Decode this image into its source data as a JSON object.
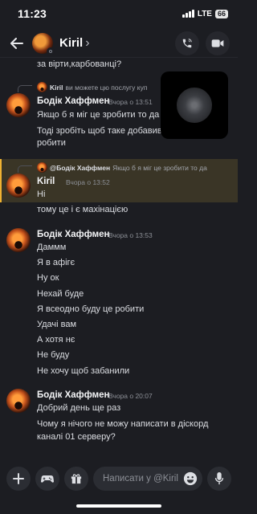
{
  "status": {
    "time": "11:23",
    "network": "LTE",
    "battery": "66"
  },
  "header": {
    "name": "Kiril",
    "chevron": "›"
  },
  "messages": {
    "prev_tail": "за вірти,карбованці?",
    "m1": {
      "reply_name": "Kiril",
      "reply_text": "ви можете цю послугу куп",
      "user": "Бодік Хаффмен",
      "time": "Вчора о 13:51",
      "lines": [
        "Якщо б я міг це зробити то да",
        "Тоді зробіть щоб таке добавив",
        "робити"
      ]
    },
    "m2": {
      "reply_name": "@Бодік Хаффмен",
      "reply_text": "Якщо б я міг це зробити то да",
      "user": "Kiril",
      "time": "Вчора о 13:52",
      "lines": [
        "Ні",
        "тому це і є махінацією"
      ]
    },
    "m3": {
      "user": "Бодік Хаффмен",
      "time": "Вчора о 13:53",
      "lines": [
        "Даммм",
        "Я в афігє",
        "Ну ок",
        "Нехай буде",
        "Я всеодно буду це робити",
        "Удачі вам",
        "А хотя нє",
        "Не буду",
        "Не хочу щоб забанили"
      ]
    },
    "m4": {
      "user": "Бодік Хаффмен",
      "time": "Вчора о 20:07",
      "lines": [
        "Добрий день ще раз",
        "Чому я нічого не можу написати в діскорд",
        "каналі 01 серверу?"
      ]
    }
  },
  "composer": {
    "placeholder": "Написати у @Kiril"
  },
  "colors": {
    "background": "#1c1d22",
    "highlight": "#3a3526",
    "mention_bar": "#f0b232"
  }
}
